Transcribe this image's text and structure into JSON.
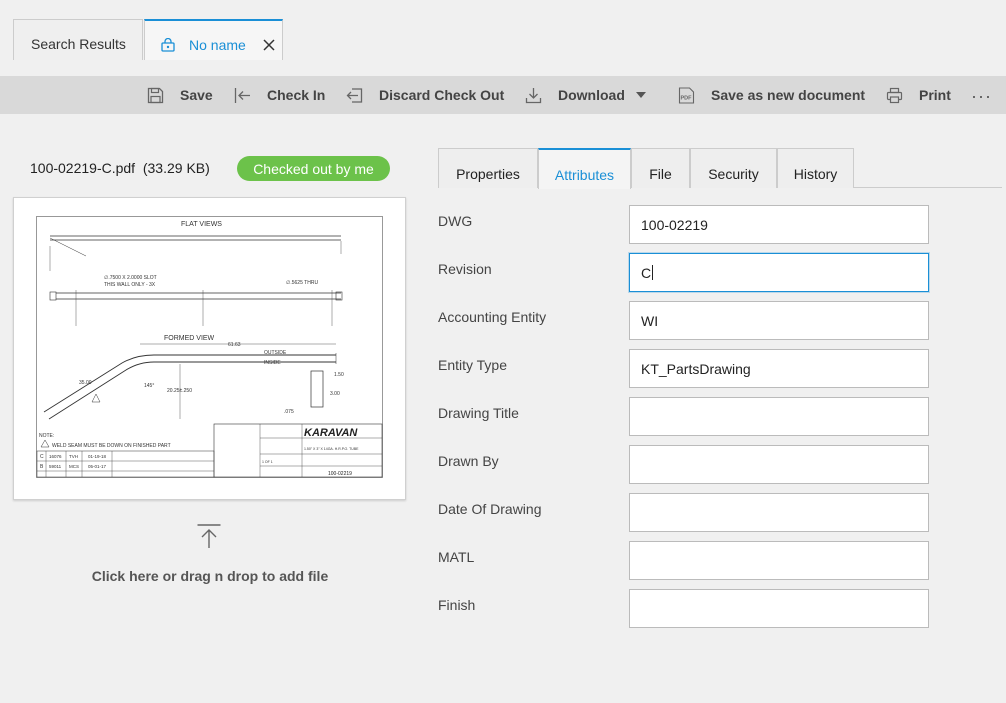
{
  "tabs": {
    "search_results": "Search Results",
    "document": "No name"
  },
  "toolbar": {
    "save": "Save",
    "check_in": "Check In",
    "discard": "Discard Check Out",
    "download": "Download",
    "save_new": "Save as new document",
    "print": "Print",
    "more": "···"
  },
  "file": {
    "name_size": "100-02219-C.pdf  (33.29 KB)",
    "status": "Checked out by me"
  },
  "preview": {
    "title_flat": "FLAT VIEWS",
    "title_formed": "FORMED VIEW",
    "note": "NOTE:",
    "weld_note": "WELD SEAM MUST BE DOWN ON FINISHED PART",
    "brand": "KARAVAN",
    "part_no": "100-02219",
    "slot": "∅.7500 X 2.0000 SLOT",
    "slot2": "THIS WALL ONLY - 3X",
    "thru": "∅.5625 THRU",
    "dim_6163": "61.63",
    "dim_3500": "35.00",
    "dim_145": "145°",
    "dim_2025": "20.25±.250",
    "dim_150": "1.50",
    "dim_300": "3.00",
    "dim_075": ".075",
    "outside": "OUTSIDE",
    "inside": "INSIDE",
    "rev_c": "C",
    "rev_c_no": "16076",
    "rev_c_by": "TVH",
    "rev_c_date": "01-19-18",
    "rev_b": "B",
    "rev_b_no": "59011",
    "rev_b_by": "MCS",
    "rev_b_date": "05-01-17",
    "matl": "1.50\" X 3\" X 14GA. H.R.P.O. TUBE",
    "sheet": "1 OF 1"
  },
  "upload": {
    "text": "Click here or drag n drop to add file"
  },
  "detail_tabs": [
    "Properties",
    "Attributes",
    "File",
    "Security",
    "History"
  ],
  "fields": [
    {
      "label": "DWG",
      "value": "100-02219"
    },
    {
      "label": "Revision",
      "value": "C"
    },
    {
      "label": "Accounting Entity",
      "value": "WI"
    },
    {
      "label": "Entity Type",
      "value": "KT_PartsDrawing"
    },
    {
      "label": "Drawing Title",
      "value": ""
    },
    {
      "label": "Drawn By",
      "value": ""
    },
    {
      "label": "Date Of Drawing",
      "value": ""
    },
    {
      "label": "MATL",
      "value": ""
    },
    {
      "label": "Finish",
      "value": ""
    }
  ],
  "colors": {
    "accent": "#1a8fd6",
    "status_green": "#6cc24a",
    "toolbar_bg": "#d9d9d9"
  }
}
